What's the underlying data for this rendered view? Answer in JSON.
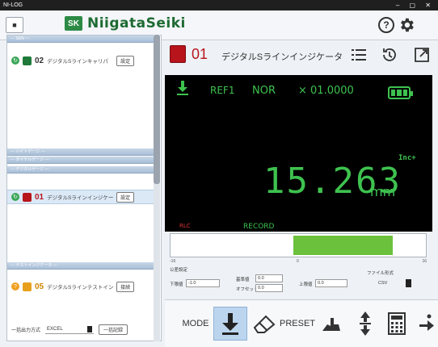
{
  "window": {
    "title": "NI-LOG"
  },
  "header": {
    "logo_mark": "SK",
    "logo_text": "NiigataSeiki"
  },
  "sidebar": {
    "groups": [
      {
        "label": "--- SEN ---"
      },
      {
        "label": "--- ハイトゲージ ---"
      },
      {
        "label": "--- ダイヤルゲージ ---"
      },
      {
        "label": "--- デジタルゲージ ---"
      },
      {
        "label": "--- テストインジケータ ---"
      }
    ],
    "items": [
      {
        "status": "online",
        "no": "02",
        "name": "デジタルSラインキャリパ",
        "button": "設定"
      },
      {
        "status": "online",
        "no": "01",
        "name": "デジタルSラインインジケータ",
        "button": "設定"
      },
      {
        "status": "warning",
        "no": "05",
        "name": "デジタルSラインテストインジケータ",
        "button": "接続"
      }
    ],
    "bottom": {
      "format_label": "一括出力方式",
      "format_value": "EXCEL",
      "export_button": "一括記録"
    }
  },
  "device": {
    "no": "01",
    "title": "デジタルSラインインジケータ"
  },
  "display": {
    "ref": "REF1",
    "mode": "NOR",
    "factor": "× 01.0000",
    "direction": "Inc+",
    "value": "15.263",
    "unit": "mm",
    "record": "RECORD",
    "rlc": "RLC",
    "battery_level": 1.0
  },
  "tolerance_bar": {
    "min_label": "-16",
    "zero_label": "0",
    "max_label": "16",
    "fill_start": 0.48,
    "fill_end": 0.87
  },
  "settings": {
    "section_label": "公差設定",
    "lower_label": "下限値",
    "lower_value": "-1.0",
    "ref_label": "基準値",
    "ref_value": "0.0",
    "offset_label": "オフセット",
    "offset_value": "0.0",
    "upper_label": "上限値",
    "upper_value": "0.0",
    "file_label": "ファイル形式",
    "file_value": "CSV"
  },
  "toolbar": {
    "mode_label": "MODE",
    "preset_label": "PRESET"
  },
  "colors": {
    "accent_green": "#3ec24f",
    "brand_green": "#1e6b32",
    "device_red": "#b8141c"
  }
}
